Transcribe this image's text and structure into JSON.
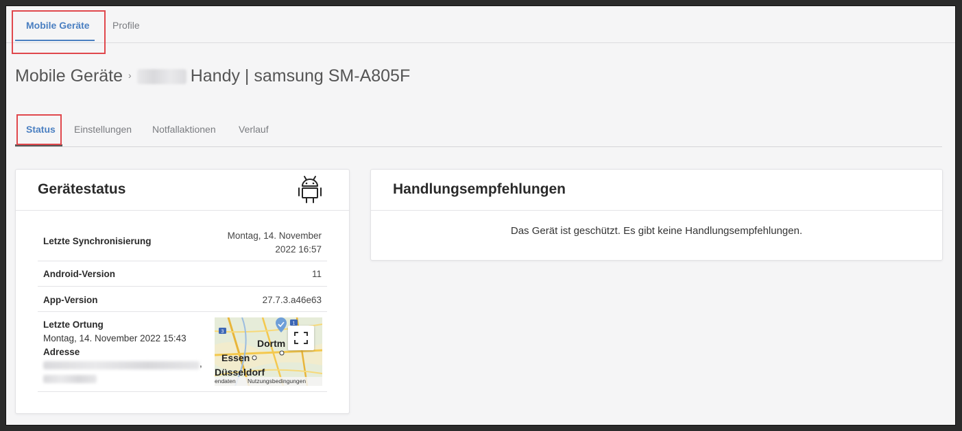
{
  "top_tabs": [
    {
      "label": "Mobile Geräte",
      "active": true
    },
    {
      "label": "Profile",
      "active": false
    }
  ],
  "breadcrumb": {
    "root": "Mobile Geräte",
    "separator": "›",
    "device_name_visible": "Handy | samsung SM-A805F"
  },
  "sub_tabs": [
    {
      "label": "Status",
      "active": true
    },
    {
      "label": "Einstellungen",
      "active": false
    },
    {
      "label": "Notfallaktionen",
      "active": false
    },
    {
      "label": "Verlauf",
      "active": false
    }
  ],
  "device_status": {
    "title": "Gerätestatus",
    "icon": "android-icon",
    "rows": [
      {
        "label": "Letzte Synchronisierung",
        "value_line1": "Montag, 14. November",
        "value_line2": "2022 16:57"
      },
      {
        "label": "Android-Version",
        "value": "11"
      },
      {
        "label": "App-Version",
        "value": "27.7.3.a46e63"
      }
    ],
    "location": {
      "label": "Letzte Ortung",
      "timestamp": "Montag, 14. November 2022 15:43",
      "address_label": "Adresse",
      "address_suffix": ",",
      "map": {
        "cities": [
          "Dortm",
          "Essen",
          "Düsseldorf"
        ],
        "road_badges": [
          "3",
          "1"
        ],
        "footer_left": "endaten",
        "footer_right": "Nutzungsbedingungen"
      }
    }
  },
  "recommendations": {
    "title": "Handlungsempfehlungen",
    "message": "Das Gerät ist geschützt. Es gibt keine Handlungsempfehlungen."
  },
  "colors": {
    "accent": "#4a7fc1",
    "highlight_box": "#e0474c",
    "page_bg": "#f5f5f6"
  }
}
